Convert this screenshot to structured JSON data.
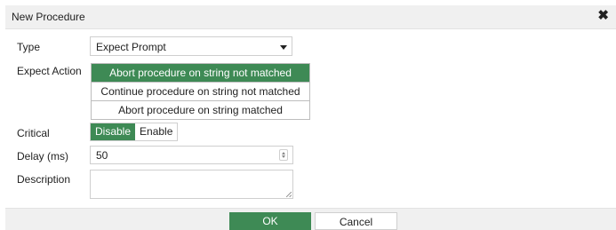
{
  "dialog": {
    "title": "New Procedure",
    "close_icon": "close-icon"
  },
  "form": {
    "type": {
      "label": "Type",
      "value": "Expect Prompt"
    },
    "expect_action": {
      "label": "Expect Action",
      "options": [
        "Abort procedure on string not matched",
        "Continue procedure on string not matched",
        "Abort procedure on string matched"
      ],
      "selected": "Abort procedure on string not matched"
    },
    "critical": {
      "label": "Critical",
      "options": [
        "Disable",
        "Enable"
      ],
      "selected": "Disable"
    },
    "delay": {
      "label": "Delay (ms)",
      "value": "50"
    },
    "description": {
      "label": "Description",
      "value": ""
    }
  },
  "footer": {
    "ok_label": "OK",
    "cancel_label": "Cancel"
  },
  "colors": {
    "accent": "#3e8a55",
    "header_bg": "#f0f0f0"
  }
}
